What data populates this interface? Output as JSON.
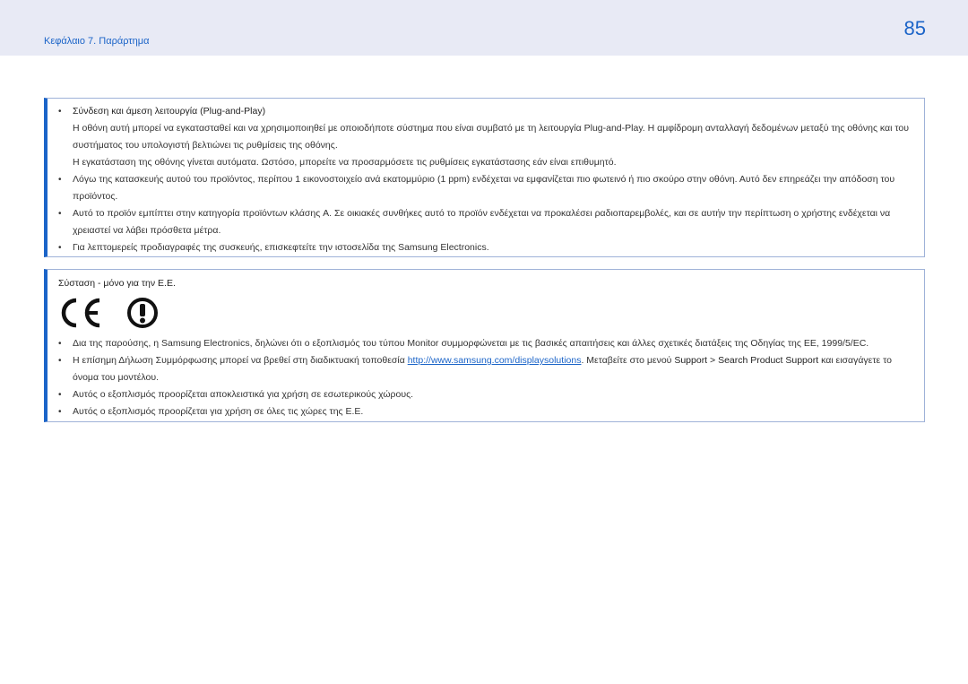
{
  "header": {
    "chapter": "Κεφάλαιο 7. Παράρτημα",
    "page_number": "85"
  },
  "section1": {
    "items": [
      {
        "title": "Σύνδεση και άμεση λειτουργία (Plug-and-Play)",
        "paragraphs": [
          "Η οθόνη αυτή μπορεί να εγκατασταθεί και να χρησιμοποιηθεί με οποιοδήποτε σύστημα που είναι συμβατό με τη λειτουργία Plug-and-Play. Η αμφίδρομη ανταλλαγή δεδομένων μεταξύ της οθόνης και του συστήματος του υπολογιστή βελτιώνει τις ρυθμίσεις της οθόνης.",
          "Η εγκατάσταση της οθόνης γίνεται αυτόματα. Ωστόσο, μπορείτε να προσαρμόσετε τις ρυθμίσεις εγκατάστασης εάν είναι επιθυμητό."
        ]
      },
      {
        "text": "Λόγω της κατασκευής αυτού του προϊόντος, περίπου 1 εικονοστοιχείο ανά εκατομμύριο (1 ppm) ενδέχεται να εμφανίζεται πιο φωτεινό ή πιο σκούρο στην οθόνη. Αυτό δεν επηρεάζει την απόδοση του προϊόντος."
      },
      {
        "text": "Αυτό το προϊόν εμπίπτει στην κατηγορία προϊόντων κλάσης A. Σε οικιακές συνθήκες αυτό το προϊόν ενδέχεται να προκαλέσει ραδιοπαρεμβολές, και σε αυτήν την περίπτωση ο χρήστης ενδέχεται να χρειαστεί να λάβει πρόσθετα μέτρα."
      },
      {
        "text": "Για λεπτομερείς προδιαγραφές της συσκευής, επισκεφτείτε την ιστοσελίδα της Samsung Electronics."
      }
    ]
  },
  "section2": {
    "title": "Σύσταση - μόνο για την Ε.Ε.",
    "item1": "Δια της παρούσης, η Samsung Electronics, δηλώνει ότι ο εξοπλισμός του τύπου Monitor συμμορφώνεται με τις βασικές απαιτήσεις και άλλες σχετικές διατάξεις της Οδηγίας της ΕΕ, 1999/5/EC.",
    "item2": {
      "prefix": "Η επίσημη Δήλωση Συμμόρφωσης μπορεί να βρεθεί στη διαδικτυακή τοποθεσία ",
      "link": "http://www.samsung.com/displaysolutions",
      "middle": ". Μεταβείτε στο μενού ",
      "menu1": "Support",
      "chevron": " > ",
      "menu2": "Search Product Support",
      "suffix": " και εισαγάγετε το όνομα του μοντέλου."
    },
    "item3": "Αυτός ο εξοπλισμός προορίζεται αποκλειστικά για χρήση σε εσωτερικούς χώρους.",
    "item4": "Αυτός ο εξοπλισμός προορίζεται για χρήση σε όλες τις χώρες της Ε.Ε."
  },
  "bullet_char": "•",
  "icons": [
    "ce-mark-icon",
    "alert-class2-icon"
  ]
}
